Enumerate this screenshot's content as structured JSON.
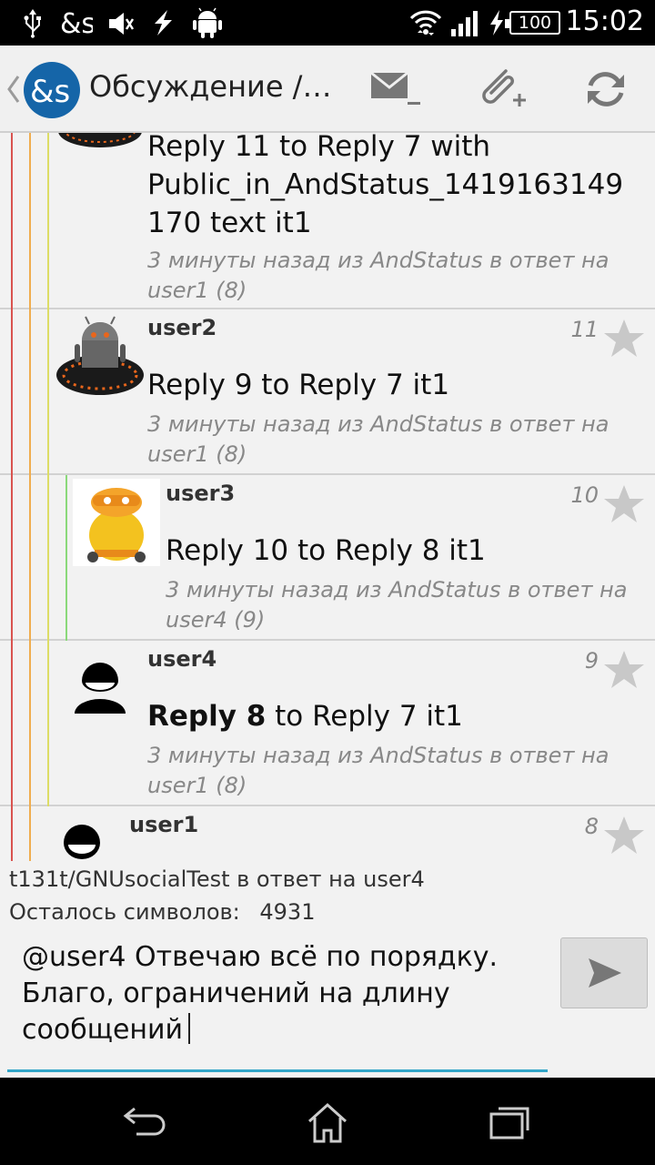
{
  "status_bar": {
    "time": "15:02",
    "battery": "100",
    "icons": [
      "usb-icon",
      "andstatus-notification-icon",
      "mute-icon",
      "flash-icon",
      "android-icon",
      "wifi-icon",
      "signal-icon",
      "charging-icon",
      "battery-icon"
    ]
  },
  "action_bar": {
    "title": "Обсуждение /…",
    "icons": [
      "back-chevron-icon",
      "app-logo-icon",
      "mail-remove-icon",
      "attach-icon",
      "refresh-icon"
    ]
  },
  "thread_items": [
    {
      "author": "",
      "number": "",
      "body": "Reply 11 to Reply 7 with Public_in_AndStatus_1419163149 170 text it1",
      "meta": "3 минуты назад из AndStatus в ответ на user1 (8)"
    },
    {
      "author": "user2",
      "number": "11",
      "body": "Reply 9 to Reply 7 it1",
      "meta": "3 минуты назад из AndStatus в ответ на user1 (8)"
    },
    {
      "author": "user3",
      "number": "10",
      "body": "Reply 10 to Reply 8 it1",
      "meta": "3 минуты назад из AndStatus в ответ на user4 (9)"
    },
    {
      "author": "user4",
      "number": "9",
      "body_bold": "Reply 8",
      "body_rest": " to Reply 7 it1",
      "meta": "3 минуты назад из AndStatus в ответ на user1 (8)"
    },
    {
      "author": "user1",
      "number": "8"
    }
  ],
  "compose": {
    "reply_info": "t131t/GNUsocialTest в ответ на user4",
    "chars_left_label": "Осталось символов:",
    "chars_left_value": "4931",
    "text": "@user4 Отвечаю всё по порядку. Благо, ограничений на длину сообщений"
  },
  "colors": {
    "thread_line_red": "#d9534f",
    "thread_line_orange": "#f0ad4e",
    "thread_line_yellow": "#dddd66",
    "thread_line_green": "#8bd97a",
    "input_underline": "#33a6c8",
    "logo_blue": "#1565a8"
  }
}
